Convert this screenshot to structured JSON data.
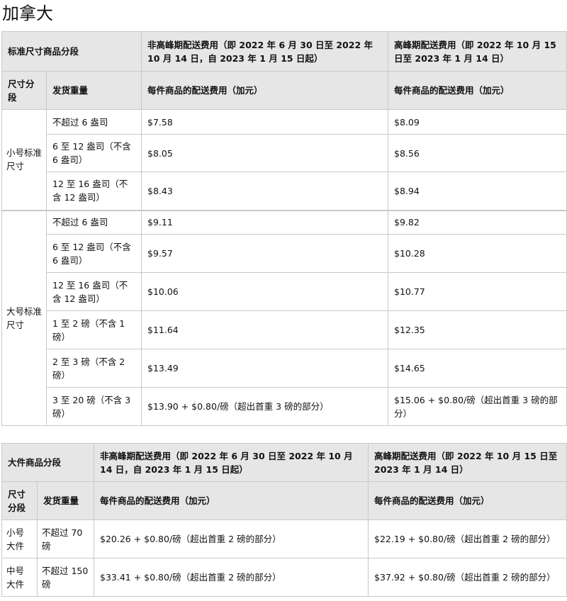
{
  "title": "加拿大",
  "standard_table": {
    "h_group": "标准尺寸商品分段",
    "h_offpeak": "非高峰期配送费用（即 2022 年 6 月 30 日至 2022 年 10 月 14 日，自 2023 年 1 月 15 日起）",
    "h_peak": "高峰期配送费用（即 2022 年 10 月 15 日至 2023 年 1 月 14 日）",
    "h_tier": "尺寸分段",
    "h_weight": "发货重量",
    "h_fee_offpeak": "每件商品的配送费用（加元）",
    "h_fee_peak": "每件商品的配送费用（加元）",
    "groups": [
      {
        "tier": "小号标准尺寸",
        "rows": [
          {
            "weight": "不超过 6 盎司",
            "offpeak": "$7.58",
            "peak": "$8.09"
          },
          {
            "weight": "6 至 12 盎司（不含 6 盎司）",
            "offpeak": "$8.05",
            "peak": "$8.56"
          },
          {
            "weight": "12 至 16 盎司（不含 12 盎司）",
            "offpeak": "$8.43",
            "peak": "$8.94"
          }
        ]
      },
      {
        "tier": "大号标准尺寸",
        "rows": [
          {
            "weight": "不超过 6 盎司",
            "offpeak": "$9.11",
            "peak": "$9.82"
          },
          {
            "weight": "6 至 12 盎司（不含 6 盎司）",
            "offpeak": "$9.57",
            "peak": "$10.28"
          },
          {
            "weight": "12 至 16 盎司（不含 12 盎司）",
            "offpeak": "$10.06",
            "peak": "$10.77"
          },
          {
            "weight": "1 至 2 磅（不含 1 磅）",
            "offpeak": "$11.64",
            "peak": "$12.35"
          },
          {
            "weight": "2 至 3 磅（不含 2 磅）",
            "offpeak": "$13.49",
            "peak": "$14.65"
          },
          {
            "weight": "3 至 20 磅（不含 3 磅）",
            "offpeak": "$13.90 + $0.80/磅（超出首重 3 磅的部分）",
            "peak": "$15.06 + $0.80/磅（超出首重 3 磅的部分）"
          }
        ]
      }
    ]
  },
  "oversize_table": {
    "h_group": "大件商品分段",
    "h_offpeak": "非高峰期配送费用（即 2022 年 6 月 30 日至 2022 年 10 月 14 日，自 2023 年 1 月 15 日起）",
    "h_peak": "高峰期配送费用（即 2022 年 10 月 15 日至 2023 年 1 月 14 日）",
    "h_tier": "尺寸分段",
    "h_weight": "发货重量",
    "h_fee_offpeak": "每件商品的配送费用（加元）",
    "h_fee_peak": "每件商品的配送费用（加元）",
    "rows": [
      {
        "tier": "小号大件",
        "weight": "不超过 70 磅",
        "offpeak": "$20.26 + $0.80/磅（超出首重 2 磅的部分）",
        "peak": "$22.19 + $0.80/磅（超出首重 2 磅的部分）"
      },
      {
        "tier": "中号大件",
        "weight": "不超过 150 磅",
        "offpeak": "$33.41 + $0.80/磅（超出首重 2 磅的部分）",
        "peak": "$37.92 + $0.80/磅（超出首重 2 磅的部分）"
      }
    ]
  }
}
